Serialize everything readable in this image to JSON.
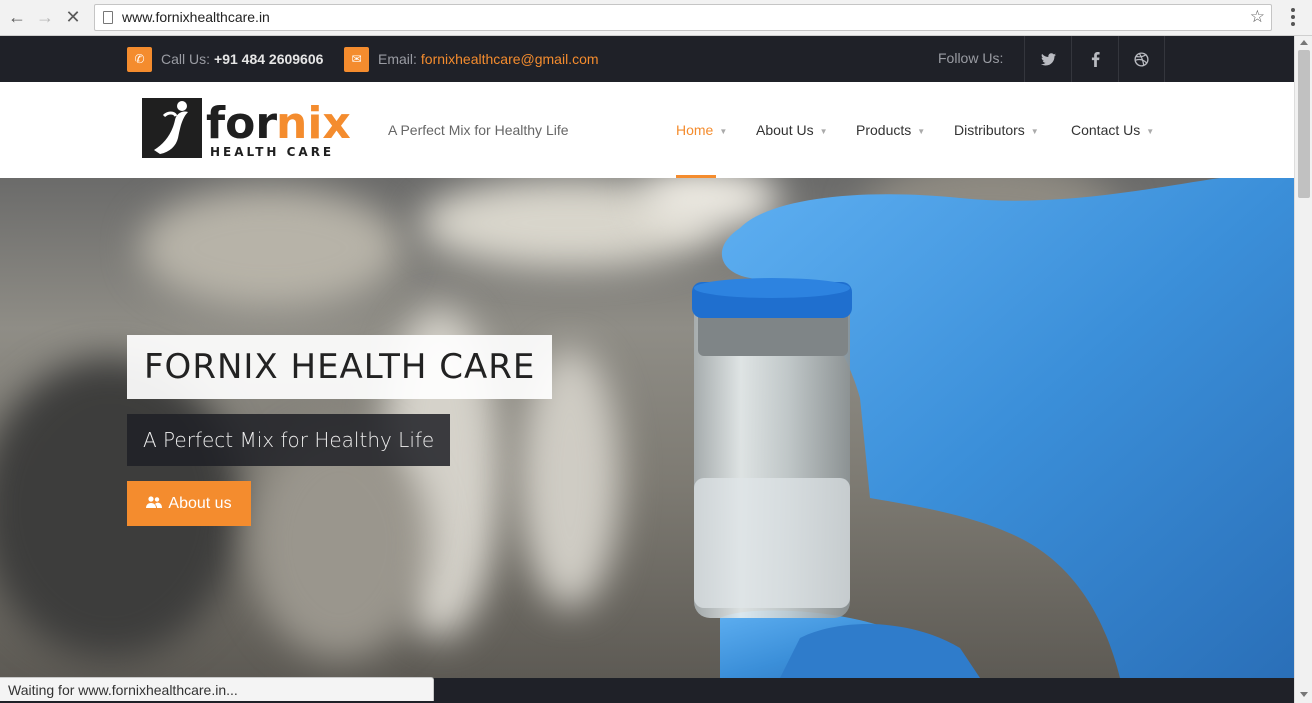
{
  "browser": {
    "url": "www.fornixhealthcare.in",
    "status_text": "Waiting for www.fornixhealthcare.in..."
  },
  "topbar": {
    "call_label": "Call Us:",
    "call_number": "+91 484 2609606",
    "email_label": "Email:",
    "email_value": "fornixhealthcare@gmail.com",
    "follow_label": "Follow Us:",
    "social_icons": [
      "twitter-icon",
      "facebook-icon",
      "dribbble-icon"
    ]
  },
  "header": {
    "logo_text_dark": "for",
    "logo_text_accent": "nix",
    "logo_subtext": "HEALTH CARE",
    "tagline": "A Perfect Mix for Healthy Life",
    "nav": [
      {
        "label": "Home",
        "active": true
      },
      {
        "label": "About Us",
        "active": false
      },
      {
        "label": "Products",
        "active": false
      },
      {
        "label": "Distributors",
        "active": false
      },
      {
        "label": "Contact Us",
        "active": false
      }
    ]
  },
  "hero": {
    "title": "FORNIX HEALTH CARE",
    "subtitle": "A Perfect Mix for Healthy Life",
    "button_label": "About us"
  },
  "colors": {
    "accent": "#f48c2e",
    "dark_bar": "#1f2128",
    "glove_blue": "#3b8fd9"
  }
}
